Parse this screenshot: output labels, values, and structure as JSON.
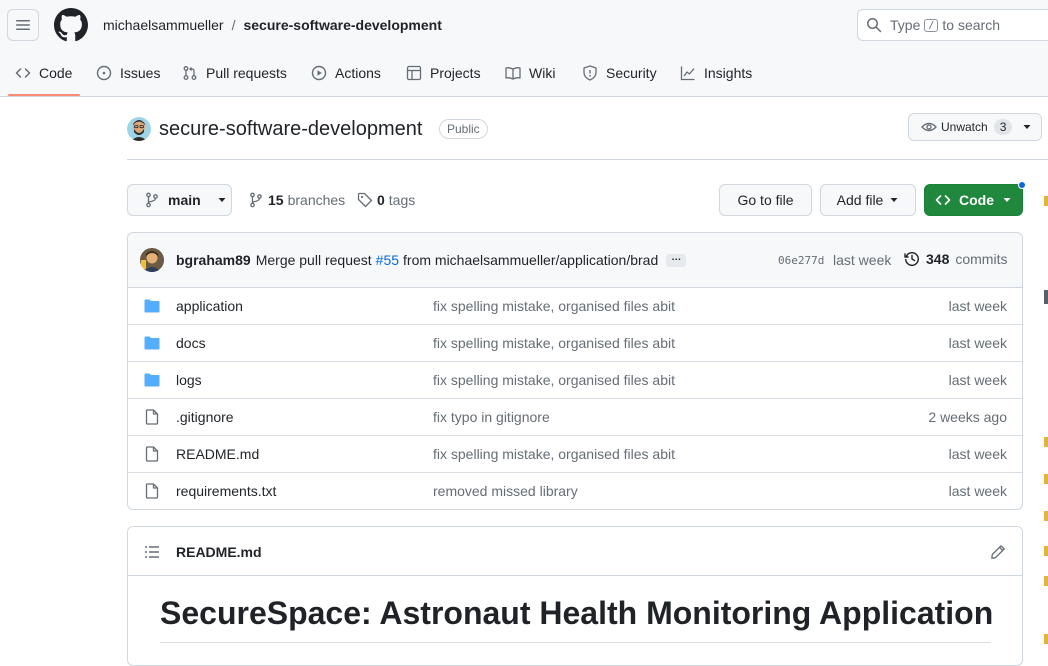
{
  "header": {
    "owner": "michaelsammueller",
    "separator": "/",
    "repo": "secure-software-development",
    "search_before": "Type",
    "search_key": "/",
    "search_after": "to search"
  },
  "tabs": [
    {
      "label": "Code",
      "icon": "code-icon"
    },
    {
      "label": "Issues",
      "icon": "issue-icon"
    },
    {
      "label": "Pull requests",
      "icon": "pull-request-icon"
    },
    {
      "label": "Actions",
      "icon": "play-icon"
    },
    {
      "label": "Projects",
      "icon": "table-icon"
    },
    {
      "label": "Wiki",
      "icon": "book-icon"
    },
    {
      "label": "Security",
      "icon": "shield-icon"
    },
    {
      "label": "Insights",
      "icon": "graph-icon"
    }
  ],
  "repo_head": {
    "title": "secure-software-development",
    "visibility": "Public",
    "watch_label": "Unwatch",
    "watch_count": "3"
  },
  "branch_bar": {
    "branch": "main",
    "branches_count": "15",
    "branches_label": "branches",
    "tags_count": "0",
    "tags_label": "tags",
    "go_to_file": "Go to file",
    "add_file": "Add file",
    "code_button": "Code"
  },
  "latest_commit": {
    "author": "bgraham89",
    "message_start": "Merge pull request",
    "pr": "#55",
    "message_end": "from michaelsammueller/application/brad",
    "ellipsis": "…",
    "sha": "06e277d",
    "time": "last week",
    "commits_count": "348",
    "commits_label": "commits"
  },
  "files": [
    {
      "type": "folder",
      "name": "application",
      "message": "fix spelling mistake, organised files abit",
      "time": "last week"
    },
    {
      "type": "folder",
      "name": "docs",
      "message": "fix spelling mistake, organised files abit",
      "time": "last week"
    },
    {
      "type": "folder",
      "name": "logs",
      "message": "fix spelling mistake, organised files abit",
      "time": "last week"
    },
    {
      "type": "file",
      "name": ".gitignore",
      "message": "fix typo in gitignore",
      "time": "2 weeks ago"
    },
    {
      "type": "file",
      "name": "README.md",
      "message": "fix spelling mistake, organised files abit",
      "time": "last week"
    },
    {
      "type": "file",
      "name": "requirements.txt",
      "message": "removed missed library",
      "time": "last week"
    }
  ],
  "readme": {
    "filename": "README.md",
    "heading": "SecureSpace: Astronaut Health Monitoring Application"
  },
  "colors": {
    "accent_green": "#1f883d",
    "link_blue": "#0969da",
    "folder_blue": "#54aeff",
    "tab_underline": "#fd8c73"
  }
}
